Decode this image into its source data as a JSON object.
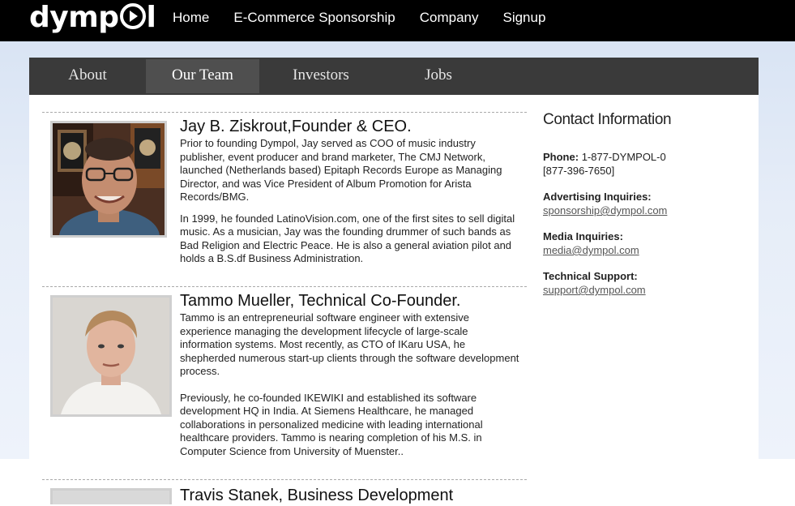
{
  "site": {
    "logo": "dymp",
    "logo_tail": "l"
  },
  "topnav": [
    "Home",
    "E-Commerce Sponsorship",
    "Company",
    "Signup"
  ],
  "subnav": {
    "tabs": [
      "About",
      "Our Team",
      "Investors",
      "Jobs"
    ],
    "active": "Our Team"
  },
  "team": [
    {
      "name": "Jay B. Ziskrout,Founder & CEO.",
      "paragraphs": [
        "Prior to founding Dympol, Jay served as COO of music industry publisher, event producer and brand marketer, The CMJ Network, launched (Netherlands based) Epitaph Records Europe as Managing Director, and was Vice President of Album Promotion for Arista Records/BMG.",
        "In 1999, he founded LatinoVision.com, one of the first sites to sell digital music. As a musician, Jay was the founding drummer of such bands as Bad Religion and Electric Peace. He is also a general aviation pilot and holds a B.S.df Business Administration."
      ]
    },
    {
      "name": "Tammo Mueller, Technical Co-Founder.",
      "paragraphs": [
        "Tammo is an entrepreneurial software engineer with extensive experience managing the development lifecycle of large-scale information systems. Most recently, as CTO of IKaru USA, he shepherded numerous start-up clients through the software development process.",
        "Previously, he co-founded IKEWIKI and established its software development HQ in India. At Siemens Healthcare, he managed collaborations in personalized medicine with leading international healthcare providers. Tammo is nearing completion of his M.S. in Computer Science from University of Muenster.."
      ]
    },
    {
      "name": "Travis Stanek, Business Development"
    }
  ],
  "contact": {
    "title": "Contact Information",
    "phone_label": "Phone:",
    "phone": "1-877-DYMPOL-0",
    "phone_alt": "[877-396-7650]",
    "advertising_label": "Advertising Inquiries:",
    "advertising_email": "sponsorship@dympol.com",
    "media_label": "Media Inquiries:",
    "media_email": "media@dympol.com",
    "support_label": "Technical Support:",
    "support_email": "support@dympol.com"
  },
  "colors": {
    "topbar": "#000000",
    "subnav": "#3a3a3a",
    "active_tab": "#4f4f4f",
    "band": "#e6edf8"
  }
}
